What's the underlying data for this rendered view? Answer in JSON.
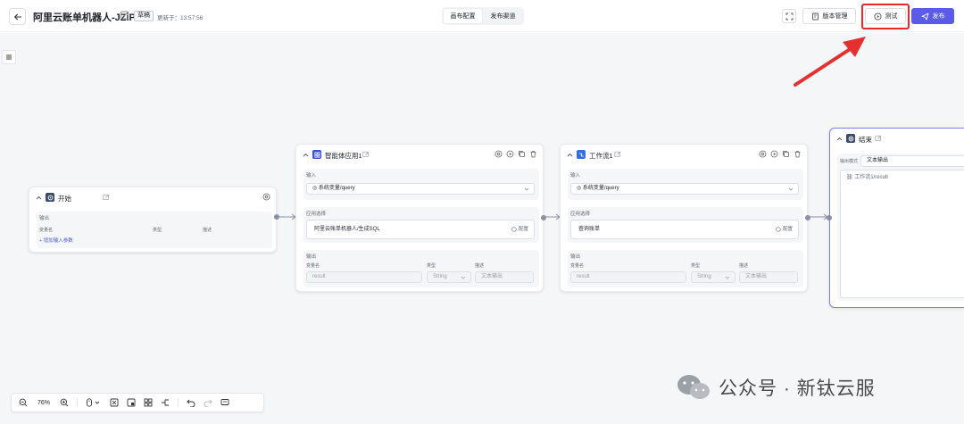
{
  "header": {
    "title": "阿里云账单机器人-JZiP",
    "draft_badge": "草稿",
    "updated_text": "更新于：13:57:56",
    "tabs": [
      {
        "label": "画布配置"
      },
      {
        "label": "发布渠道"
      }
    ],
    "version_label": "版本管理",
    "test_label": "测试",
    "publish_label": "发布",
    "accent_color": "#5b5bea",
    "highlight_color": "#ea2828"
  },
  "nodes": {
    "start": {
      "title": "开始",
      "output_label": "输出",
      "col_var": "变量名",
      "col_type": "类型",
      "col_desc": "描述",
      "add_param": "增加输入参数"
    },
    "agent": {
      "title": "智能体应用1",
      "input_label": "输入",
      "input_value": "系统变量/query",
      "app_label": "应用选择",
      "app_value": "阿里云账单机器人/生成SQL",
      "config_label": "配置",
      "output_label": "输出",
      "col_var": "变量名",
      "col_type": "类型",
      "col_desc": "描述",
      "out_var": "result",
      "out_type": "String",
      "out_desc": "文本输出"
    },
    "workflow": {
      "title": "工作流1",
      "input_label": "输入",
      "input_value": "系统变量/query",
      "app_label": "应用选择",
      "app_value": "查询账单",
      "config_label": "配置",
      "output_label": "输出",
      "col_var": "变量名",
      "col_type": "类型",
      "col_desc": "描述",
      "out_var": "result",
      "out_type": "String",
      "out_desc": "文本输出"
    },
    "end": {
      "title": "结束",
      "mode_label": "输出模式",
      "mode_value": "文本输出",
      "ref_value": "工作流1/result"
    }
  },
  "toolbar": {
    "zoom": "76%"
  },
  "watermark": {
    "text": "公众号 · 新钛云服"
  }
}
